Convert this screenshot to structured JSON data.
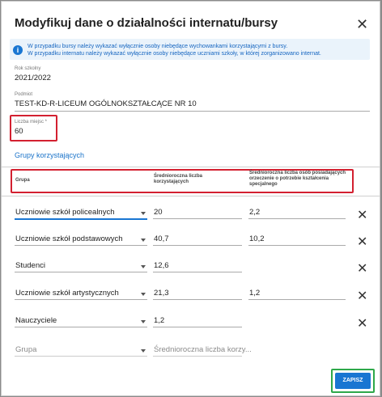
{
  "dialog": {
    "title": "Modyfikuj dane o działalności internatu/bursy",
    "close_icon": "close-icon",
    "info_lines": [
      "W przypadku bursy należy wykazać wyłącznie osoby niebędące wychowankami korzystającymi z bursy.",
      "W przypadku internatu należy wykazać wyłącznie osoby niebędące uczniami szkoły, w której zorganizowano internat."
    ]
  },
  "fields": {
    "school_year": {
      "label": "Rok szkolny",
      "value": "2021/2022"
    },
    "entity": {
      "label": "Podmiot",
      "value": "TEST-KD-R-LICEUM OGÓLNOKSZTAŁCĄCE NR 10"
    },
    "places": {
      "label": "Liczba miejsc *",
      "value": "60"
    }
  },
  "groups": {
    "title": "Grupy korzystających",
    "headers": {
      "group": "Grupa",
      "avg": "Średnioroczna liczba korzystających",
      "avg_special": "Średnioroczna liczba osób posiadających orzeczenie o potrzebie kształcenia specjalnego"
    },
    "rows": [
      {
        "group": "Uczniowie szkół policealnych",
        "avg": "20",
        "special": "2,2"
      },
      {
        "group": "Uczniowie szkół podstawowych",
        "avg": "40,7",
        "special": "10,2"
      },
      {
        "group": "Studenci",
        "avg": "12,6",
        "special": ""
      },
      {
        "group": "Uczniowie szkół artystycznych",
        "avg": "21,3",
        "special": "1,2"
      },
      {
        "group": "Nauczyciele",
        "avg": "1,2",
        "special": ""
      }
    ],
    "new_row": {
      "group_placeholder": "Grupa",
      "avg_placeholder": "Średnioroczna liczba korzy..."
    }
  },
  "actions": {
    "save_label": "ZAPISZ"
  },
  "colors": {
    "accent": "#1976d2",
    "highlight_red": "#d32030",
    "highlight_green": "#2ea84a"
  }
}
